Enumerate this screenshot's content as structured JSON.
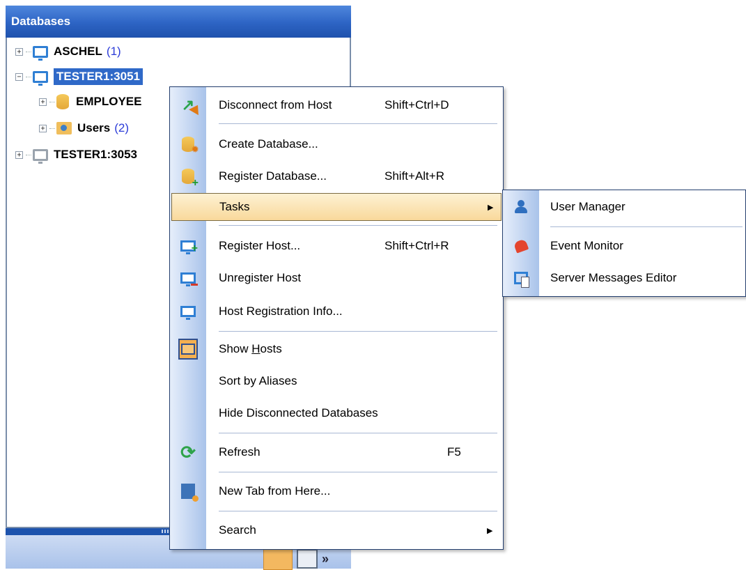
{
  "panel": {
    "title": "Databases"
  },
  "tree": {
    "nodes": [
      {
        "label": "ASCHEL",
        "count": "(1)",
        "icon": "monitor-icon"
      },
      {
        "label": "TESTER1:3051",
        "icon": "monitor-icon",
        "selected": true
      },
      {
        "label": "EMPLOYEE",
        "icon": "database-icon"
      },
      {
        "label": "Users",
        "count": "(2)",
        "icon": "folder-users-icon"
      },
      {
        "label": "TESTER1:3053",
        "icon": "monitor-gray-icon"
      }
    ]
  },
  "menu": {
    "items": [
      {
        "label": "Disconnect from Host",
        "shortcut": "Shift+Ctrl+D",
        "icon": "disconnect-icon"
      },
      {
        "label": "Create Database...",
        "shortcut": "",
        "icon": "create-database-icon"
      },
      {
        "label": "Register Database...",
        "shortcut": "Shift+Alt+R",
        "icon": "register-database-icon"
      },
      {
        "label": "Tasks",
        "shortcut": "",
        "submenu": true,
        "highlighted": true
      },
      {
        "label": "Register Host...",
        "shortcut": "Shift+Ctrl+R",
        "icon": "register-host-icon"
      },
      {
        "label": "Unregister Host",
        "shortcut": "",
        "icon": "unregister-host-icon"
      },
      {
        "label": "Host Registration Info...",
        "shortcut": "",
        "icon": "host-info-icon"
      },
      {
        "label_pre": "Show ",
        "label_u": "H",
        "label_post": "osts",
        "icon": "show-hosts-icon",
        "checked": true
      },
      {
        "label": "Sort by Aliases",
        "shortcut": ""
      },
      {
        "label": "Hide Disconnected Databases",
        "shortcut": ""
      },
      {
        "label": "Refresh",
        "shortcut": "F5",
        "icon": "refresh-icon"
      },
      {
        "label": "New Tab from Here...",
        "shortcut": "",
        "icon": "new-tab-icon"
      },
      {
        "label": "Search",
        "shortcut": "",
        "submenu": true
      }
    ]
  },
  "submenu": {
    "items": [
      {
        "label": "User Manager",
        "icon": "user-manager-icon"
      },
      {
        "label": "Event Monitor",
        "icon": "event-monitor-icon"
      },
      {
        "label": "Server Messages Editor",
        "icon": "server-messages-icon"
      }
    ]
  },
  "colors": {
    "header_blue": "#2d64c4",
    "selection_blue": "#2f69c8",
    "highlight_gold": "#f9d99b",
    "gutter_blue": "#a9c3ea"
  }
}
